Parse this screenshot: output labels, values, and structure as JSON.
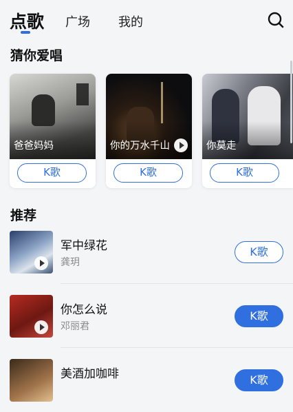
{
  "tabs": {
    "active": "点歌",
    "plaza": "广场",
    "mine": "我的"
  },
  "accent_color": "#2f6fe0",
  "sections": {
    "guess_title": "猜你爱唱",
    "recommend_title": "推荐"
  },
  "guess_cards": [
    {
      "title": "爸爸妈妈",
      "button": "K歌"
    },
    {
      "title": "你的万水千山",
      "button": "K歌"
    },
    {
      "title": "你莫走",
      "button": "K歌"
    }
  ],
  "recommend": [
    {
      "title": "军中绿花",
      "artist": "龚玥",
      "button": "K歌"
    },
    {
      "title": "你怎么说",
      "artist": "邓丽君",
      "button": "K歌"
    },
    {
      "title": "美酒加咖啡",
      "artist": "",
      "button": "K歌"
    }
  ],
  "icons": {
    "search": "search-icon",
    "play": "play-icon"
  }
}
